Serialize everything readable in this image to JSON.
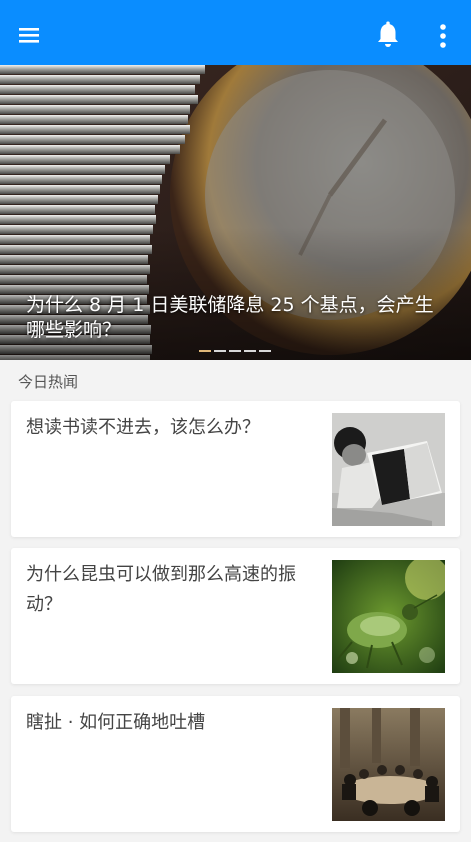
{
  "app_bar": {
    "background": "#0a8dff",
    "icons": [
      "menu-icon",
      "bell-icon",
      "more-vert-icon"
    ]
  },
  "hero": {
    "title": "为什么 8 月 1 日美联储降息 25 个基点，会产生哪些影响？",
    "indicator_count": 5,
    "active_index": 0,
    "image": "coins-and-clock-photo"
  },
  "section": {
    "label": "今日热闻"
  },
  "stories": [
    {
      "title": "想读书读不进去，该怎么办？",
      "thumb": "child-reading-book-photo"
    },
    {
      "title": "为什么昆虫可以做到那么高速的振动？",
      "thumb": "green-insect-on-leaf-photo"
    },
    {
      "title": "瞎扯 · 如何正确地吐槽",
      "thumb": "group-around-table-photo"
    }
  ]
}
